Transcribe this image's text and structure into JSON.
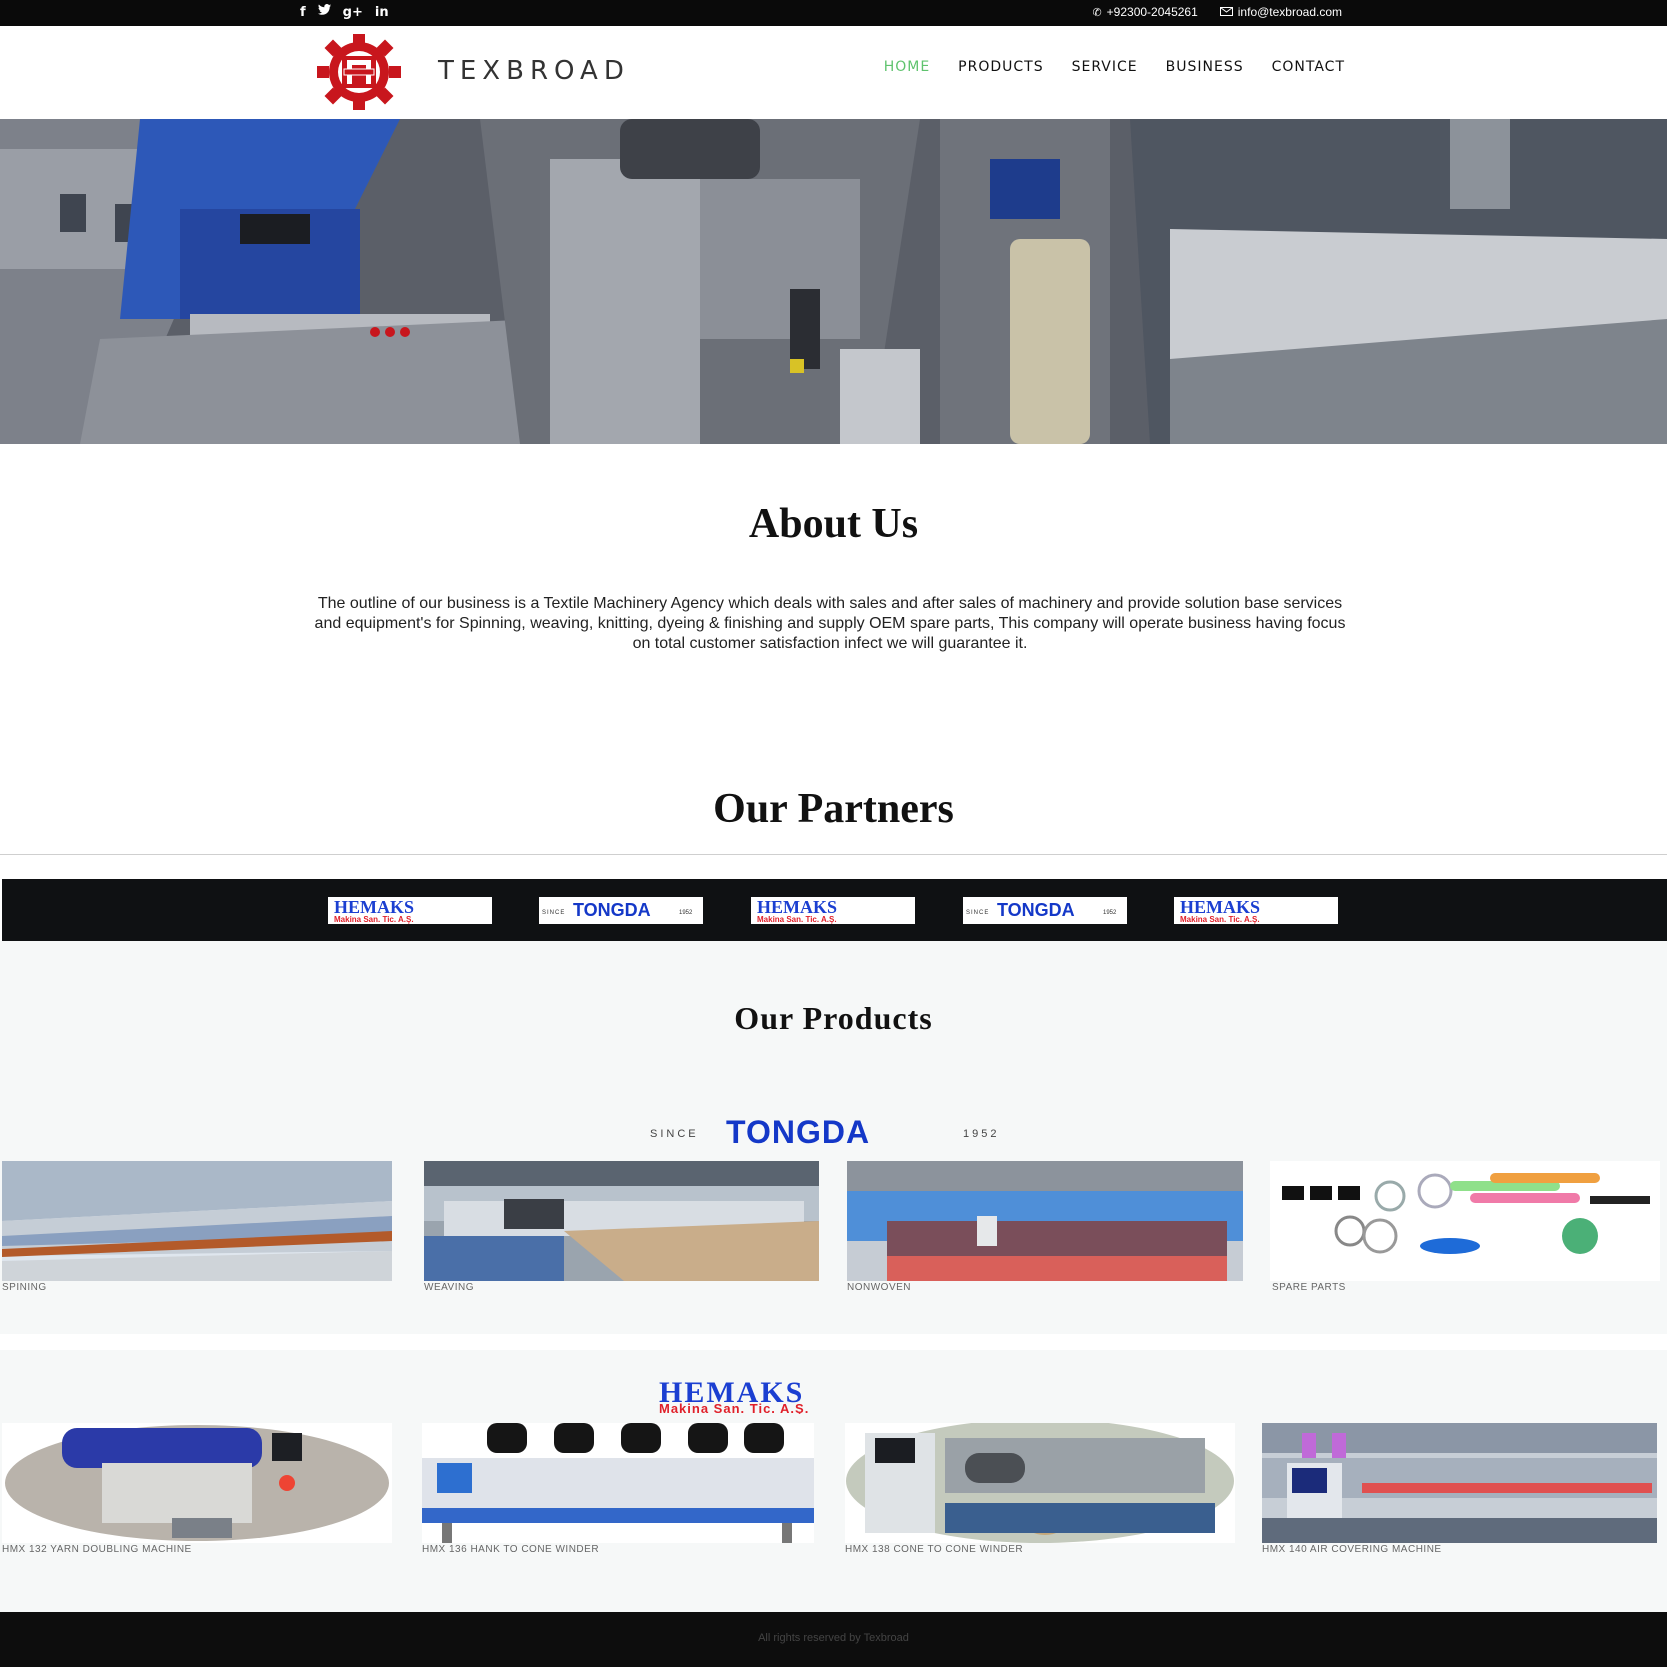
{
  "topbar": {
    "social": [
      {
        "name": "facebook-icon",
        "glyph": "f"
      },
      {
        "name": "twitter-icon",
        "glyph": "t"
      },
      {
        "name": "google-plus-icon",
        "glyph": "g+"
      },
      {
        "name": "linkedin-icon",
        "glyph": "in"
      }
    ],
    "phone_icon": "phone-icon",
    "phone": "+92300-2045261",
    "email_icon": "mail-icon",
    "email": "info@texbroad.com"
  },
  "header": {
    "brand": "TEXBROAD",
    "logo": "texbroad-gear-logo",
    "nav": [
      {
        "label": "HOME",
        "active": true
      },
      {
        "label": "PRODUCTS",
        "active": false
      },
      {
        "label": "SERVICE",
        "active": false
      },
      {
        "label": "BUSINESS",
        "active": false
      },
      {
        "label": "CONTACT",
        "active": false
      }
    ],
    "accent": "#5fc36e",
    "logo_red": "#c8161d"
  },
  "hero": {
    "image": "textile-machinery-factory"
  },
  "about": {
    "title": "About Us",
    "text": "The outline of our business is a Textile Machinery Agency which deals with sales and after sales of machinery and provide solution base services and equipment's for Spinning, weaving, knitting, dyeing & finishing and supply OEM spare parts, This company will operate business having focus on total customer satisfaction infect we will guarantee it."
  },
  "partners": {
    "title": "Our Partners",
    "logos": [
      "HEMAKS",
      "TONGDA",
      "HEMAKS",
      "TONGDA",
      "HEMAKS"
    ]
  },
  "logos": {
    "hemaks_name": "HEMAKS",
    "hemaks_sub": "Makina San. Tic. A.Ş.",
    "tongda_since": "SINCE",
    "tongda_name": "TONGDA",
    "tongda_year": "1952",
    "hemaks_blue": "#1b3fd1",
    "hemaks_red": "#e0202a",
    "tongda_blue": "#1438c8"
  },
  "products": {
    "title": "Our Products",
    "tongda": [
      {
        "label": "SPINING"
      },
      {
        "label": "WEAVING"
      },
      {
        "label": "NONWOVEN"
      },
      {
        "label": "SPARE PARTS"
      }
    ],
    "hemaks": [
      {
        "label": "HMX 132 YARN DOUBLING MACHINE"
      },
      {
        "label": "HMX 136 HANK TO CONE WINDER"
      },
      {
        "label": "HMX 138 CONE TO CONE WINDER"
      },
      {
        "label": "HMX 140 AIR COVERING MACHINE"
      }
    ]
  },
  "footer": {
    "text": "All rights reserved by Texbroad"
  }
}
